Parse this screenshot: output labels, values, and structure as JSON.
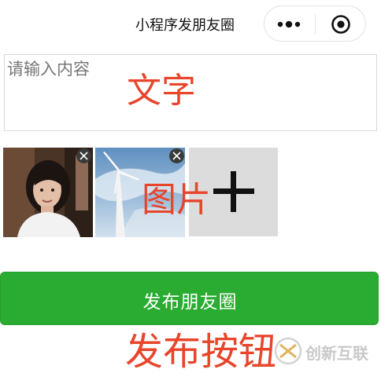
{
  "navbar": {
    "title": "小程序发朋友圈",
    "more_icon": "more-dots-icon",
    "close_icon": "target-close-icon"
  },
  "post": {
    "placeholder": "请输入内容"
  },
  "images": [
    {
      "name": "portrait-photo",
      "delete_icon": "delete-x-icon"
    },
    {
      "name": "wind-turbine-photo",
      "delete_icon": "delete-x-icon"
    }
  ],
  "add_image_icon": "plus-icon",
  "publish": {
    "label": "发布朋友圈",
    "color": "#2aab31"
  },
  "annotations": {
    "text": "文字",
    "image": "图片",
    "button": "发布按钮",
    "color": "#e8452b"
  },
  "watermark": {
    "text": "创新互联"
  }
}
